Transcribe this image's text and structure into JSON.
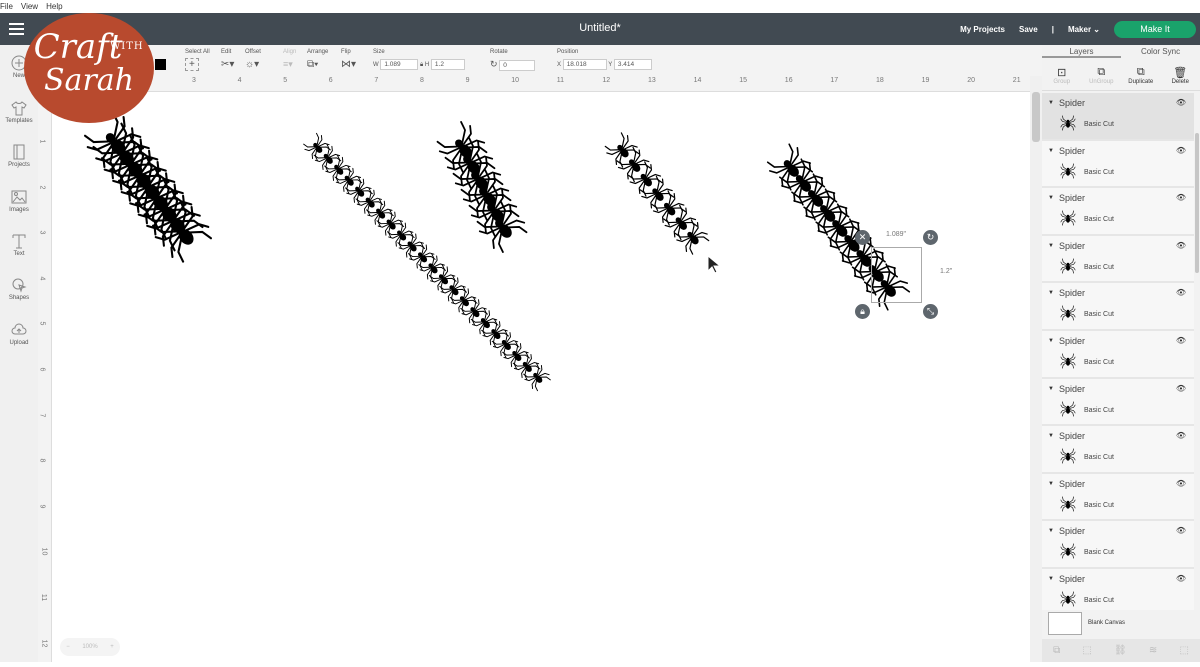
{
  "menu": [
    "File",
    "View",
    "Help"
  ],
  "header": {
    "title": "Untitled*",
    "my_projects": "My Projects",
    "save": "Save",
    "separator": "|",
    "machine": "Maker",
    "make_it": "Make It",
    "make_it_color": "#1aa36b"
  },
  "logo": {
    "text1": "Craft",
    "text2": "WITH",
    "text3": "Sarah"
  },
  "sidebar": [
    {
      "label": "New"
    },
    {
      "label": "Templates"
    },
    {
      "label": "Projects"
    },
    {
      "label": "Images"
    },
    {
      "label": "Text"
    },
    {
      "label": "Shapes"
    },
    {
      "label": "Upload"
    }
  ],
  "toolbar": {
    "select_all": "Select All",
    "edit": "Edit",
    "offset": "Offset",
    "align": "Align",
    "arrange": "Arrange",
    "flip": "Flip",
    "size": "Size",
    "w_label": "W",
    "w": "1.089",
    "h_label": "H",
    "h": "1.2",
    "rotate": "Rotate",
    "rotate_value": "0",
    "position": "Position",
    "x_label": "X",
    "x": "18.018",
    "y_label": "Y",
    "y": "3.414"
  },
  "ruler_top": [
    "3",
    "4",
    "5",
    "6",
    "7",
    "8",
    "9",
    "10",
    "11",
    "12",
    "13",
    "14",
    "15",
    "16",
    "17",
    "18",
    "19",
    "20",
    "21"
  ],
  "ruler_left": [
    "1",
    "2",
    "3",
    "4",
    "5",
    "6",
    "7",
    "8",
    "9",
    "10",
    "11",
    "12"
  ],
  "selection": {
    "width_label": "1.089\"",
    "height_label": "1.2\""
  },
  "zoom": {
    "value": "100%",
    "minus": "−",
    "plus": "+"
  },
  "panel": {
    "tabs": [
      "Layers",
      "Color Sync"
    ],
    "actions": [
      "Group",
      "UnGroup",
      "Duplicate",
      "Delete"
    ],
    "layers": [
      {
        "name": "Spider",
        "op": "Basic Cut"
      },
      {
        "name": "Spider",
        "op": "Basic Cut"
      },
      {
        "name": "Spider",
        "op": "Basic Cut"
      },
      {
        "name": "Spider",
        "op": "Basic Cut"
      },
      {
        "name": "Spider",
        "op": "Basic Cut"
      },
      {
        "name": "Spider",
        "op": "Basic Cut"
      },
      {
        "name": "Spider",
        "op": "Basic Cut"
      },
      {
        "name": "Spider",
        "op": "Basic Cut"
      },
      {
        "name": "Spider",
        "op": "Basic Cut"
      },
      {
        "name": "Spider",
        "op": "Basic Cut"
      },
      {
        "name": "Spider",
        "op": "Basic Cut"
      }
    ],
    "blank_canvas": "Blank Canvas"
  }
}
